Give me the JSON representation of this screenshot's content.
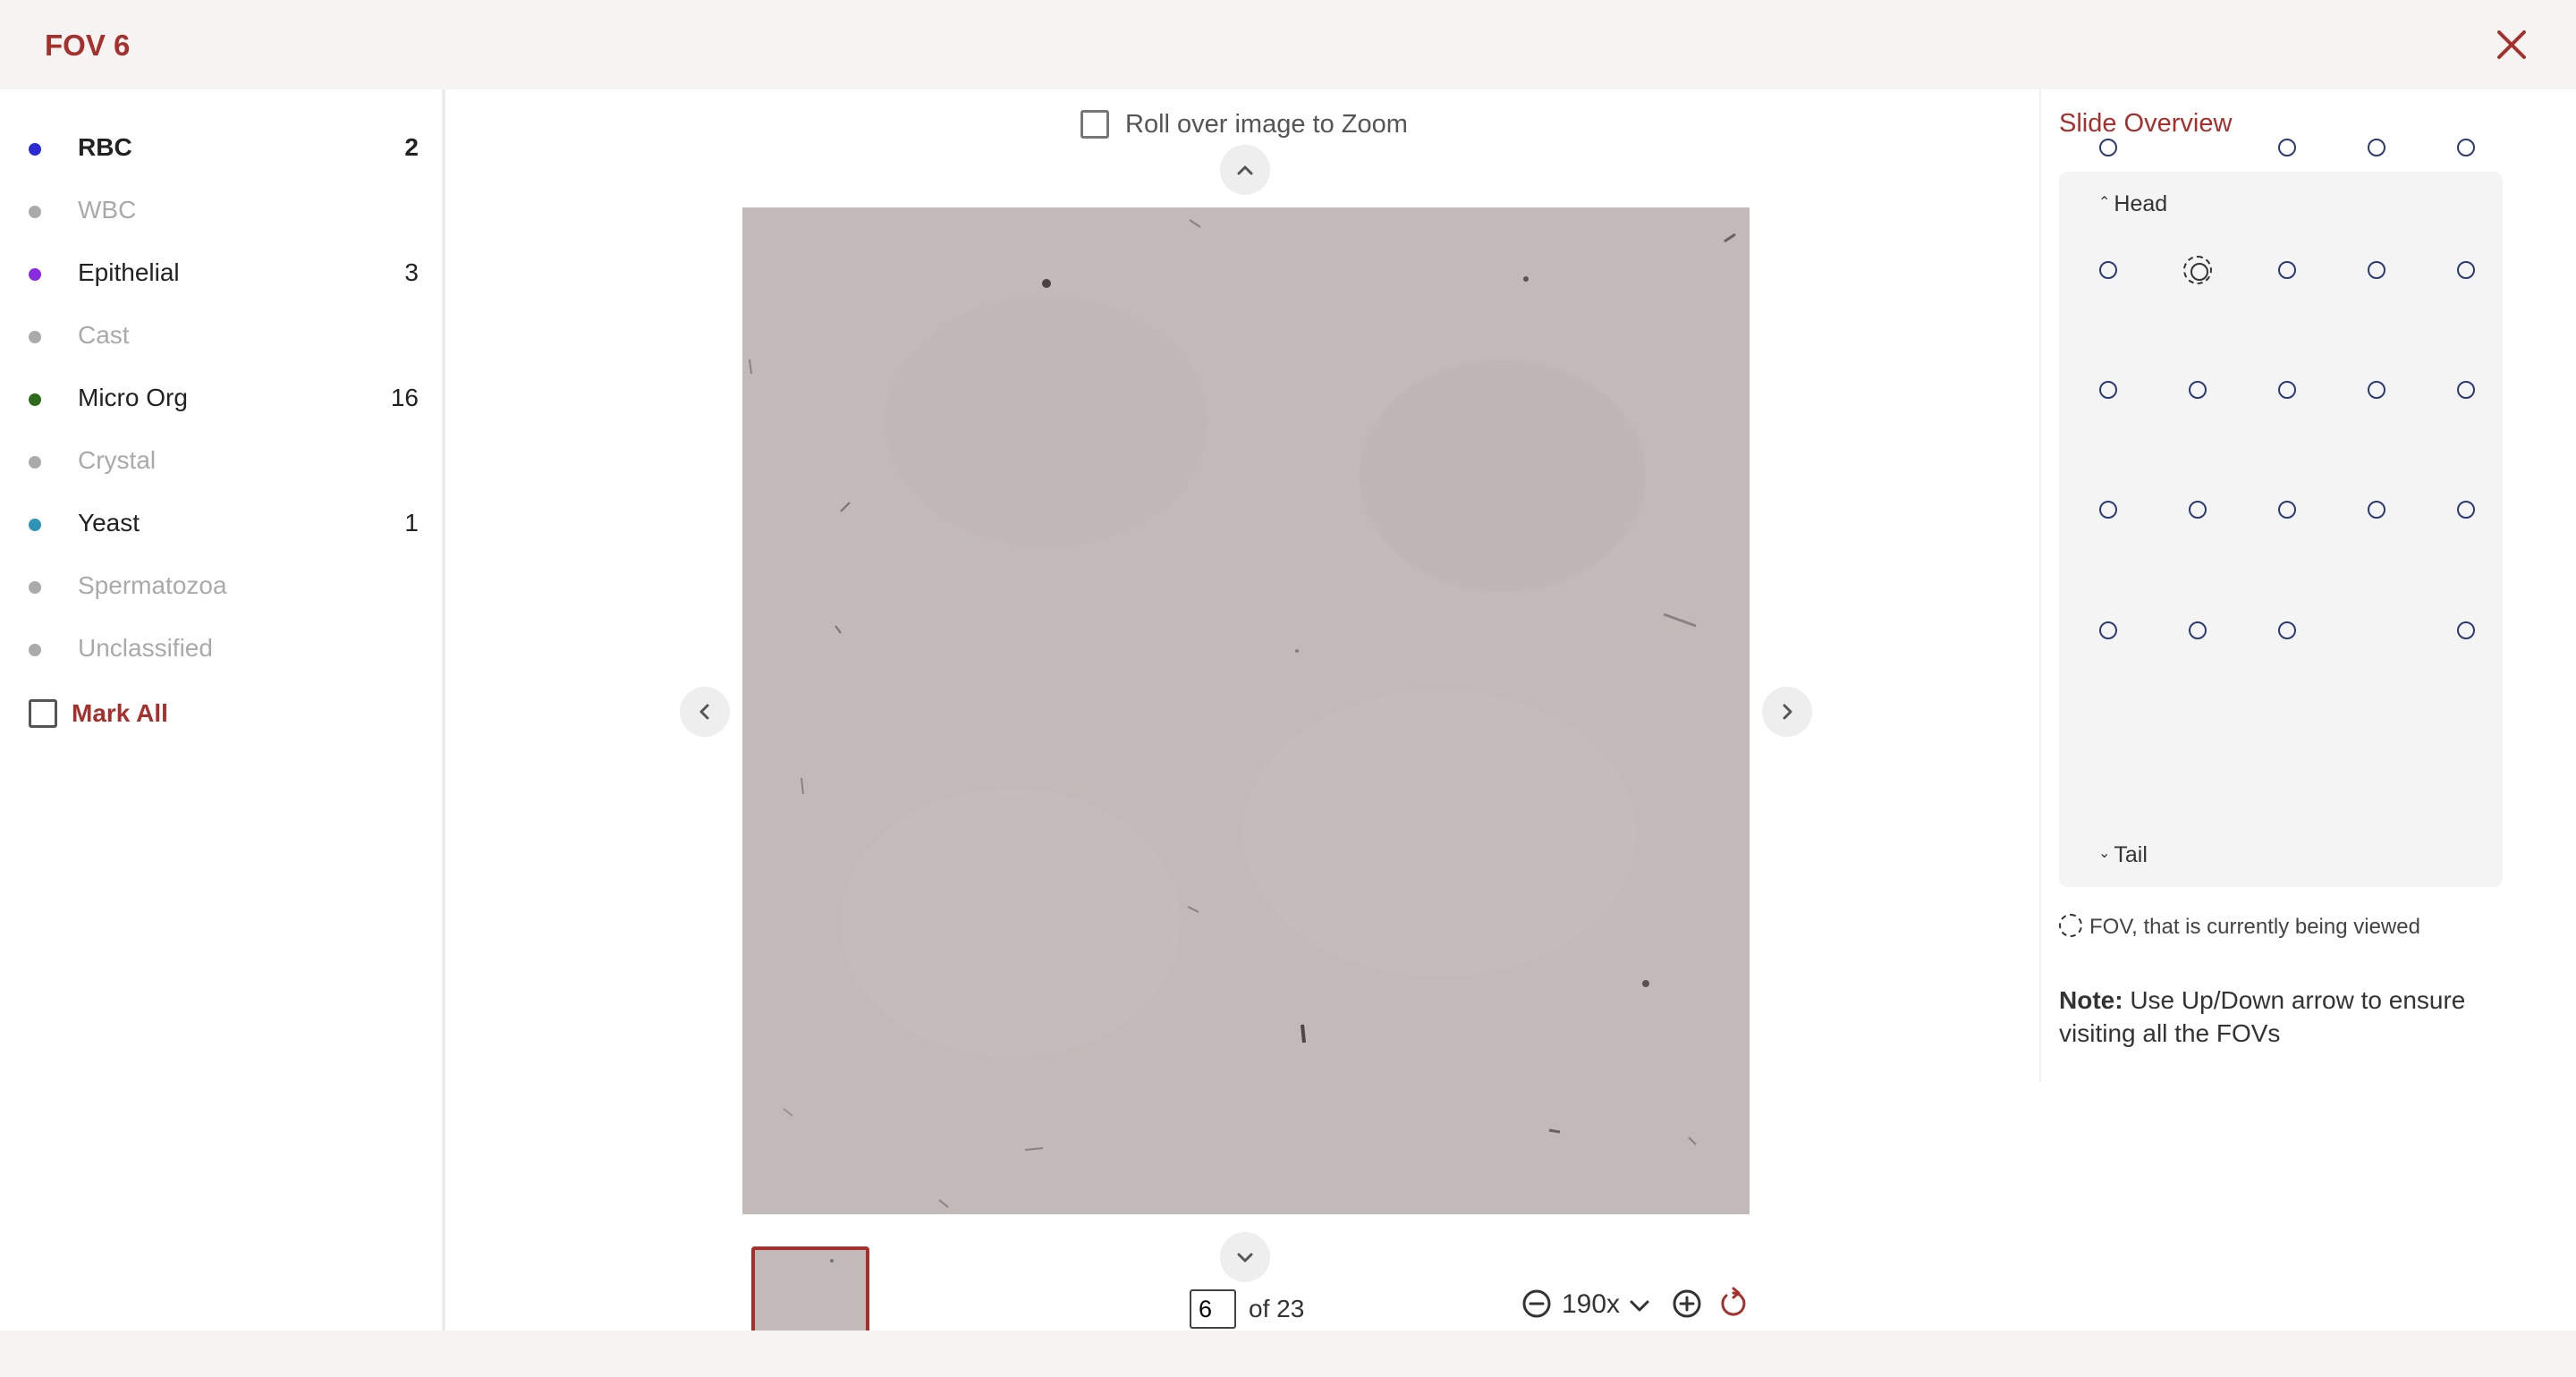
{
  "header": {
    "title": "FOV 6"
  },
  "legend": [
    {
      "label": "RBC",
      "count": "2",
      "color": "#2b2bd3",
      "state": "selected"
    },
    {
      "label": "WBC",
      "count": "",
      "color": "#aaaaaa",
      "state": "disabled"
    },
    {
      "label": "Epithelial",
      "count": "3",
      "color": "#8a2be2",
      "state": "active"
    },
    {
      "label": "Cast",
      "count": "",
      "color": "#aaaaaa",
      "state": "disabled"
    },
    {
      "label": "Micro Org",
      "count": "16",
      "color": "#2e6b1a",
      "state": "active"
    },
    {
      "label": "Crystal",
      "count": "",
      "color": "#aaaaaa",
      "state": "disabled"
    },
    {
      "label": "Yeast",
      "count": "1",
      "color": "#2e95b8",
      "state": "active"
    },
    {
      "label": "Spermatozoa",
      "count": "",
      "color": "#aaaaaa",
      "state": "disabled"
    },
    {
      "label": "Unclassified",
      "count": "",
      "color": "#aaaaaa",
      "state": "disabled"
    }
  ],
  "mark_all": {
    "label": "Mark All",
    "checked": false
  },
  "viewer": {
    "zoom_toggle_label": "Roll over image to Zoom",
    "zoom_toggle_checked": false,
    "current_page": "6",
    "page_total_label": "of 23",
    "zoom_level": "190x"
  },
  "overview": {
    "title": "Slide Overview",
    "head_label": "Head",
    "tail_label": "Tail",
    "grid": [
      [
        1,
        0,
        1,
        1,
        1
      ],
      [
        1,
        2,
        1,
        1,
        1
      ],
      [
        1,
        1,
        1,
        1,
        1
      ],
      [
        1,
        1,
        1,
        1,
        1
      ],
      [
        1,
        1,
        1,
        0,
        1
      ]
    ],
    "current_legend": "FOV, that is currently being viewed",
    "note_label": "Note:",
    "note_text": " Use Up/Down arrow to ensure visiting all the FOVs"
  },
  "colors": {
    "accent": "#a5312e",
    "fov_dot": "#2c3a72",
    "image_bg": "#c2b9b9"
  },
  "icons": {
    "close": "close-icon",
    "up": "chevron-up-icon",
    "down": "chevron-down-icon",
    "prev": "chevron-left-icon",
    "next": "chevron-right-icon",
    "zoom_out": "zoom-out-icon",
    "zoom_in": "zoom-in-icon",
    "reset": "reset-icon"
  }
}
